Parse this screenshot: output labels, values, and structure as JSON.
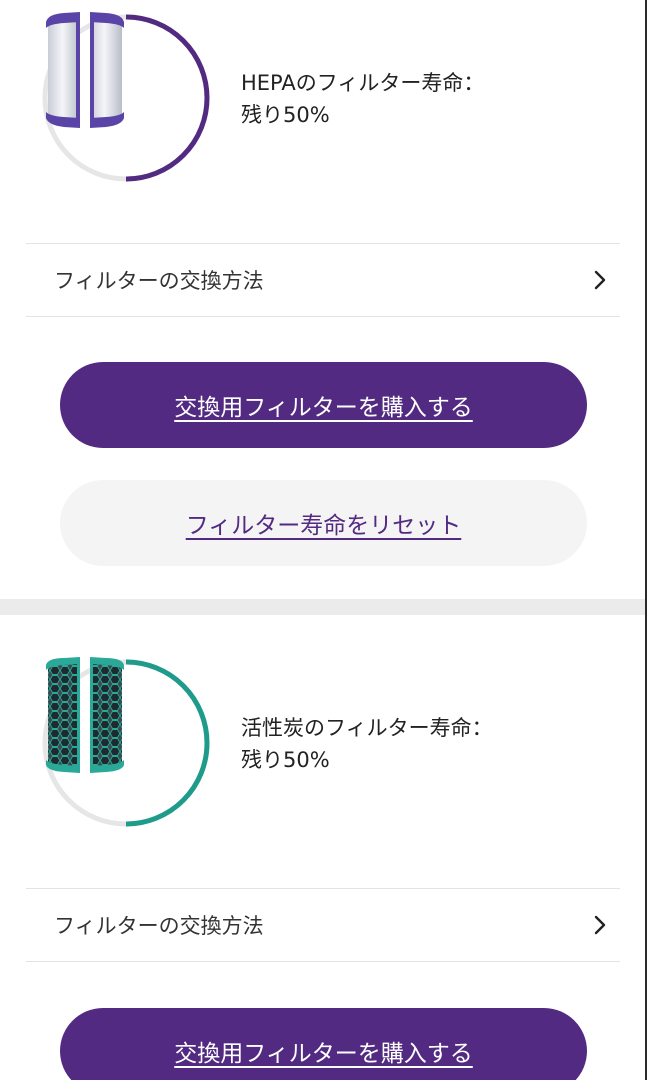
{
  "sections": [
    {
      "life_label": "HEPAのフィルター寿命：",
      "life_remaining": "残り50%",
      "life_fraction": 0.5,
      "accent_color": "#532a82",
      "filter_image": "hepa-filter",
      "howto_label": "フィルターの交換方法",
      "buy_label": "交換用フィルターを購入する",
      "reset_label": "フィルター寿命をリセット"
    },
    {
      "life_label": "活性炭のフィルター寿命：",
      "life_remaining": "残り50%",
      "life_fraction": 0.5,
      "accent_color": "#1f9b8c",
      "filter_image": "carbon-filter",
      "howto_label": "フィルターの交換方法",
      "buy_label": "交換用フィルターを購入する"
    }
  ],
  "colors": {
    "primary_purple": "#532a82",
    "gauge_track": "#e6e6e6",
    "secondary_bg": "#f4f4f4",
    "divider": "#ebebeb"
  }
}
